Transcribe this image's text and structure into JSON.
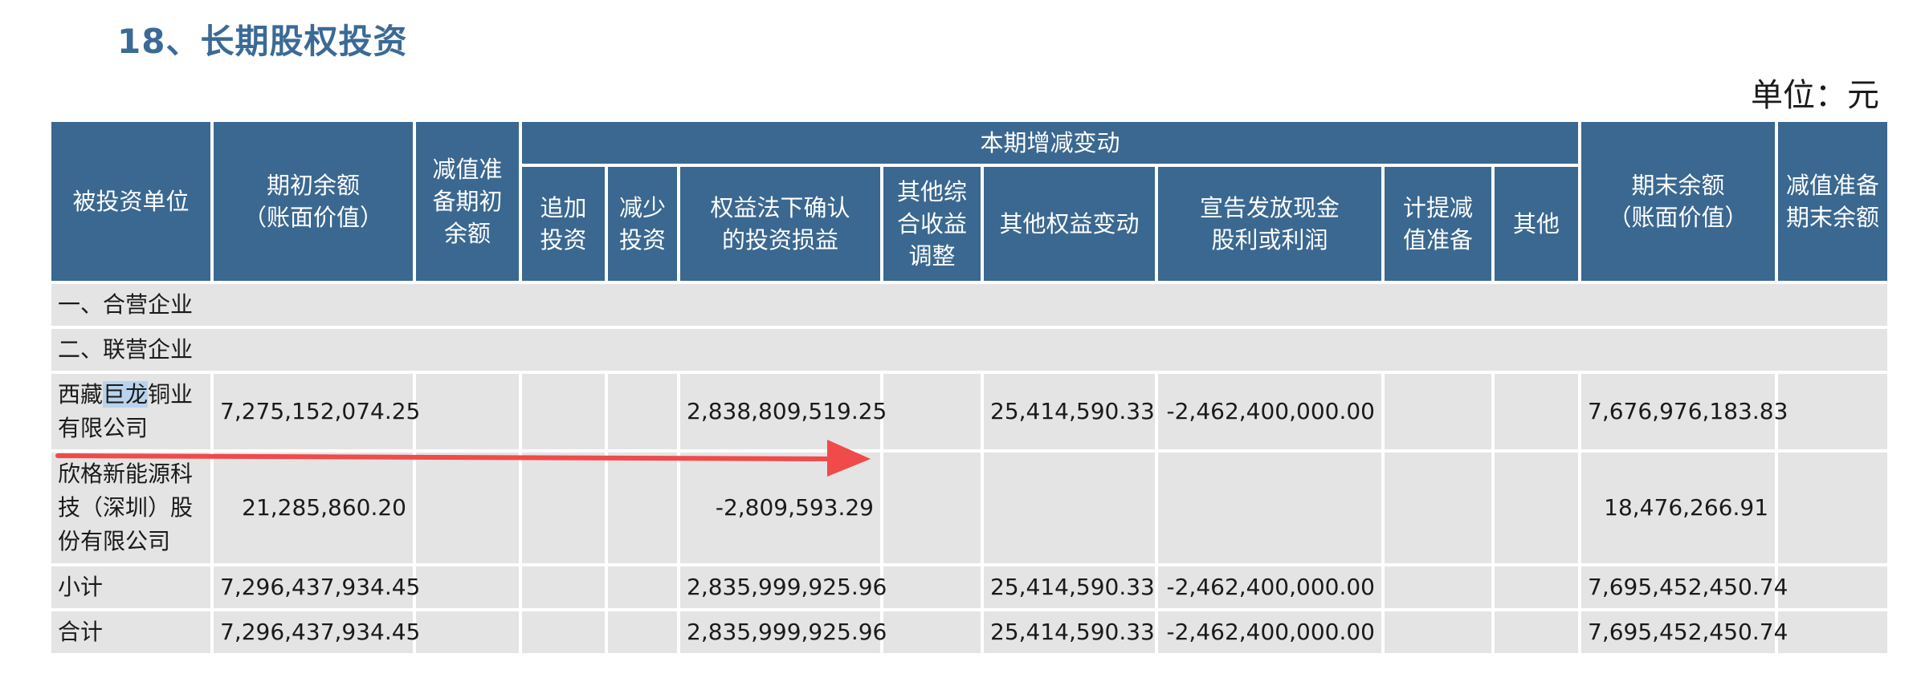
{
  "title": "18、长期股权投资",
  "unit": "单位：元",
  "headers": {
    "investee": "被投资单位",
    "opening": [
      "期初余额",
      "（账面价值）"
    ],
    "impairment_opening": [
      "减值准",
      "备期初",
      "余额"
    ],
    "changes_group": "本期增减变动",
    "add_invest": [
      "追加",
      "投资"
    ],
    "reduce_invest": [
      "减少",
      "投资"
    ],
    "equity_method": [
      "权益法下确认",
      "的投资损益"
    ],
    "oci": [
      "其他综",
      "合收益",
      "调整"
    ],
    "other_equity": "其他权益变动",
    "dividend": [
      "宣告发放现金",
      "股利或利润"
    ],
    "impairment_provision": [
      "计提减",
      "值准备"
    ],
    "other": "其他",
    "closing": [
      "期末余额",
      "（账面价值）"
    ],
    "impairment_closing": [
      "减值准备",
      "期末余额"
    ]
  },
  "sections": {
    "joint_ventures": "一、合营企业",
    "associates": "二、联营企业"
  },
  "rows": [
    {
      "name_part1": "西藏",
      "name_highlight": "巨龙",
      "name_part2": "铜业有限公司",
      "opening": "7,275,152,074.25",
      "equity_method": "2,838,809,519.25",
      "other_equity": "25,414,590.33",
      "dividend": "-2,462,400,000.00",
      "closing": "7,676,976,183.83"
    },
    {
      "name": "欣格新能源科技（深圳）股份有限公司",
      "opening": "21,285,860.20",
      "equity_method": "-2,809,593.29",
      "closing": "18,476,266.91"
    }
  ],
  "subtotal": {
    "label": "小计",
    "opening": "7,296,437,934.45",
    "equity_method": "2,835,999,925.96",
    "other_equity": "25,414,590.33",
    "dividend": "-2,462,400,000.00",
    "closing": "7,695,452,450.74"
  },
  "total": {
    "label": "合计",
    "opening": "7,296,437,934.45",
    "equity_method": "2,835,999,925.96",
    "other_equity": "25,414,590.33",
    "dividend": "-2,462,400,000.00",
    "closing": "7,695,452,450.74"
  },
  "colors": {
    "header_bg": "#3a6890",
    "title": "#3b6a96",
    "row_bg": "#e4e4e4",
    "arrow": "#f04a4a",
    "highlight": "#b9d3ee"
  }
}
